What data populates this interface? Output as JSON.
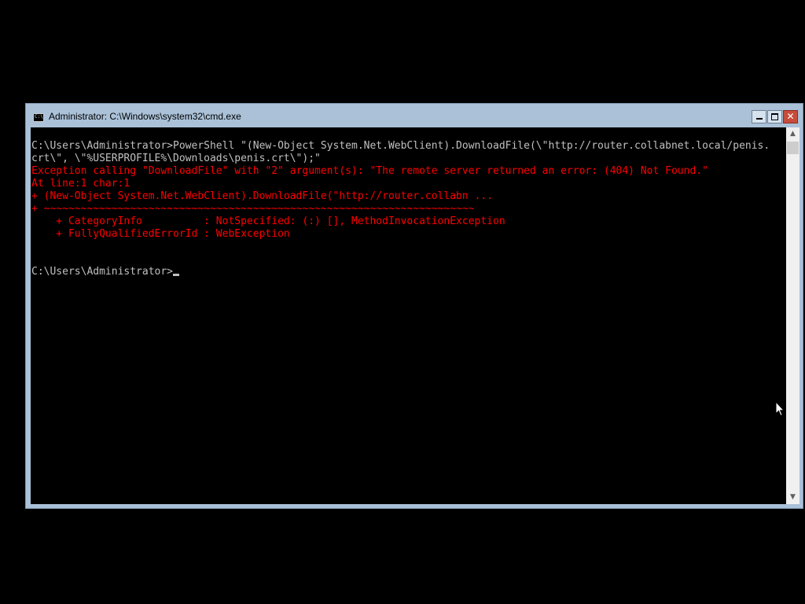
{
  "window": {
    "title": "Administrator: C:\\Windows\\system32\\cmd.exe",
    "icon": "cmd-icon",
    "icon_text": "C:\\"
  },
  "controls": {
    "minimize_icon": "minimize-icon",
    "maximize_icon": "maximize-icon",
    "close_icon": "close-icon",
    "close_glyph": "✕"
  },
  "colors": {
    "titlebar": "#aac1d8",
    "console_bg": "#000000",
    "console_text": "#c0c0c0",
    "error_text": "#ff0000",
    "close_button": "#c74c3c"
  },
  "console": {
    "lines": [
      {
        "text": "",
        "color": "white"
      },
      {
        "text": "C:\\Users\\Administrator>PowerShell \"(New-Object System.Net.WebClient).DownloadFile(\\\"http://router.collabnet.local/penis.",
        "color": "white"
      },
      {
        "text": "crt\\\", \\\"%USERPROFILE%\\Downloads\\penis.crt\\\");\"",
        "color": "white"
      },
      {
        "text": "Exception calling \"DownloadFile\" with \"2\" argument(s): \"The remote server returned an error: (404) Not Found.\"",
        "color": "red"
      },
      {
        "text": "At line:1 char:1",
        "color": "red"
      },
      {
        "text": "+ (New-Object System.Net.WebClient).DownloadFile(\"http://router.collabn ...",
        "color": "red"
      },
      {
        "text": "+ ~~~~~~~~~~~~~~~~~~~~~~~~~~~~~~~~~~~~~~~~~~~~~~~~~~~~~~~~~~~~~~~~~~~~~~",
        "color": "red"
      },
      {
        "text": "    + CategoryInfo          : NotSpecified: (:) [], MethodInvocationException",
        "color": "red"
      },
      {
        "text": "    + FullyQualifiedErrorId : WebException",
        "color": "red"
      },
      {
        "text": "",
        "color": "white"
      },
      {
        "text": "",
        "color": "white"
      }
    ],
    "prompt": "C:\\Users\\Administrator>"
  },
  "scrollbar": {
    "up_arrow": "▲",
    "down_arrow": "▼",
    "up_icon": "scroll-up-arrow-icon",
    "down_icon": "scroll-down-arrow-icon"
  },
  "pointer": {
    "icon": "mouse-pointer-icon"
  }
}
